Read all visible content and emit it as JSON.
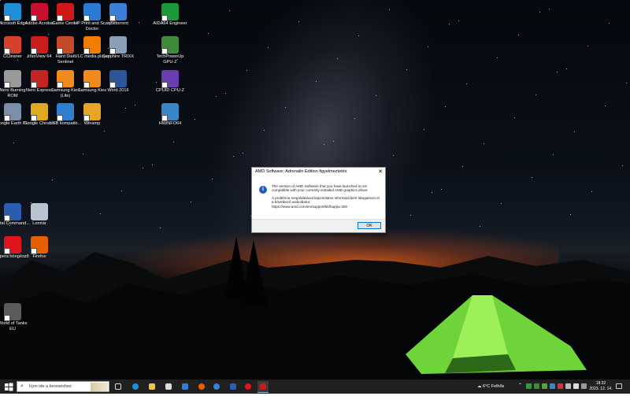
{
  "desktop_icons": [
    {
      "id": "edge",
      "label": "Microsoft Edge",
      "icon": "edge-icon",
      "color": "#1f8fd8"
    },
    {
      "id": "acrobat",
      "label": "Adobe Acrobat",
      "icon": "acrobat-icon",
      "color": "#c8102e"
    },
    {
      "id": "gamecenter",
      "label": "Game Center",
      "icon": "game-center-icon",
      "color": "#d01818"
    },
    {
      "id": "hpscan",
      "label": "HP Print and Scan Doctor",
      "icon": "hp-print-scan-icon",
      "color": "#2b7bd4"
    },
    {
      "id": "qbittorrent",
      "label": "qBittorrent",
      "icon": "qbittorrent-icon",
      "color": "#3b7fd9"
    },
    {
      "id": "aida",
      "label": "AIDA64 Engineer",
      "icon": "aida64-icon",
      "color": "#1b9a3c"
    },
    {
      "id": "ccleaner",
      "label": "CCleaner",
      "icon": "ccleaner-icon",
      "color": "#d9402b"
    },
    {
      "id": "irfanview",
      "label": "IrfanView 64",
      "icon": "irfanview-icon",
      "color": "#c91d1d"
    },
    {
      "id": "hdsentinel",
      "label": "Hard Disk Sentinel",
      "icon": "hard-disk-sentinel-icon",
      "color": "#c54a2a"
    },
    {
      "id": "vlc",
      "label": "VLC media player",
      "icon": "vlc-icon",
      "color": "#f07d00"
    },
    {
      "id": "sapphire",
      "label": "Sapphire TRIXX",
      "icon": "sapphire-trixx-icon",
      "color": "#8aa0b8"
    },
    {
      "id": "gpuz",
      "label": "TechPowerUp GPU-Z",
      "icon": "gpu-z-icon",
      "color": "#3f8a3a"
    },
    {
      "id": "nero",
      "label": "Nero Burning ROM",
      "icon": "nero-burning-rom-icon",
      "color": "#9a9a9a"
    },
    {
      "id": "neroexpress",
      "label": "Nero Express",
      "icon": "nero-express-icon",
      "color": "#c52424"
    },
    {
      "id": "kieslite",
      "label": "Samsung Kies (Lite)",
      "icon": "samsung-kies-lite-icon",
      "color": "#f08a1c"
    },
    {
      "id": "kies",
      "label": "Samsung Kies",
      "icon": "samsung-kies-icon",
      "color": "#f08a1c"
    },
    {
      "id": "word",
      "label": "Word 2016",
      "icon": "word-icon",
      "color": "#2b579a"
    },
    {
      "id": "cpuz",
      "label": "CPUID CPU-Z",
      "icon": "cpu-z-icon",
      "color": "#6a3db0"
    },
    {
      "id": "googleearth",
      "label": "Google Earth Pro",
      "icon": "google-earth-icon",
      "color": "#7a8ea8"
    },
    {
      "id": "chrome",
      "label": "Google Chrome",
      "icon": "chrome-icon",
      "color": "#e0a81f"
    },
    {
      "id": "usbtemp",
      "label": "USB kompatib...",
      "icon": "usb-compat-icon",
      "color": "#2f7fd0"
    },
    {
      "id": "winamp",
      "label": "Winamp",
      "icon": "winamp-icon",
      "color": "#e8a423"
    },
    {
      "id": "hwinfo",
      "label": "HWiNFO64",
      "icon": "hwinfo-icon",
      "color": "#3a86c8"
    },
    {
      "id": "totalcmd",
      "label": "Total Command...",
      "icon": "total-commander-icon",
      "color": "#2a5db0"
    },
    {
      "id": "recycle",
      "label": "Lomtár",
      "icon": "recycle-bin-icon",
      "color": "#b8c4d0"
    },
    {
      "id": "opera",
      "label": "Opera böngésző",
      "icon": "opera-icon",
      "color": "#e0141e"
    },
    {
      "id": "firefox",
      "label": "Firefox",
      "icon": "firefox-icon",
      "color": "#e66000"
    },
    {
      "id": "wot",
      "label": "World of Tanks EU",
      "icon": "world-of-tanks-icon",
      "color": "#5a5a5a"
    }
  ],
  "dialog": {
    "title": "AMD Software: Adrenalin Edition figyelmeztetés",
    "message1": "The version of AMD Software that you have launched is not compatible with your currently installed AMD graphics driver.",
    "message2": "A probléma megoldásával kapcsolatos információkért látogasson el a következő weboldalra:",
    "url": "https://www.amd.com/en/support/kb/faq/pa-300",
    "ok_label": "OK"
  },
  "taskbar": {
    "search_placeholder": "Írjon ide a kereséshez",
    "weather": "6°C  Felhős",
    "time": "18:32",
    "date": "2023. 12. 14."
  }
}
